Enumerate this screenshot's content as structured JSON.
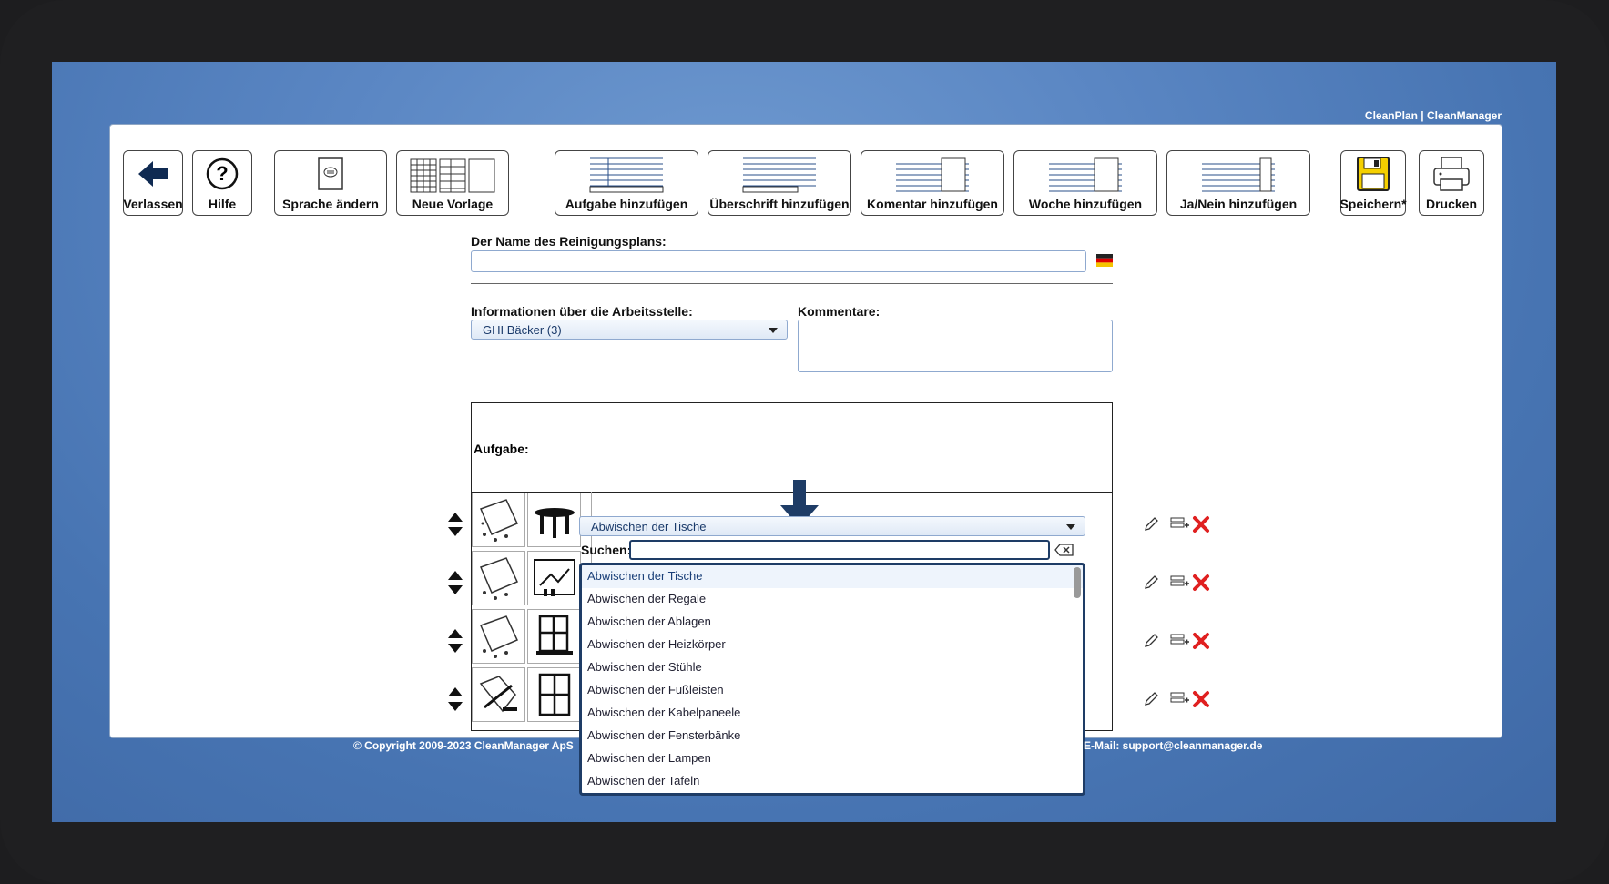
{
  "app": {
    "brand": "CleanPlan | CleanManager"
  },
  "toolbar": [
    {
      "label": "Verlassen",
      "icon": "arrow-left-icon"
    },
    {
      "label": "Hilfe",
      "icon": "help-icon"
    },
    {
      "label": "Sprache ändern",
      "icon": "language-icon"
    },
    {
      "label": "Neue Vorlage",
      "icon": "new-template-icon"
    },
    {
      "label": "Aufgabe hinzufügen",
      "icon": "add-task-icon"
    },
    {
      "label": "Überschrift hinzufügen",
      "icon": "add-heading-icon"
    },
    {
      "label": "Komentar hinzufügen",
      "icon": "add-comment-icon"
    },
    {
      "label": "Woche hinzufügen",
      "icon": "add-week-icon"
    },
    {
      "label": "Ja/Nein hinzufügen",
      "icon": "add-yes-no-icon"
    },
    {
      "label": "Speichern*",
      "icon": "save-icon"
    },
    {
      "label": "Drucken",
      "icon": "print-icon"
    }
  ],
  "form": {
    "plan_name_label": "Der Name des Reinigungsplans:",
    "plan_name_value": "",
    "workplace_label": "Informationen über die Arbeitsstelle:",
    "workplace_value": "GHI Bäcker (3)",
    "comments_label": "Kommentare:",
    "comments_value": ""
  },
  "tasks": {
    "header": "Aufgabe:",
    "selected": "Abwischen der Tische",
    "search_label": "Suchen:",
    "search_value": "",
    "options": [
      "Abwischen der Tische",
      "Abwischen der Regale",
      "Abwischen der Ablagen",
      "Abwischen der Heizkörper",
      "Abwischen der Stühle",
      "Abwischen der Fußleisten",
      "Abwischen der Kabelpaneele",
      "Abwischen der Fensterbänke",
      "Abwischen der Lampen",
      "Abwischen der Tafeln"
    ]
  },
  "footer": {
    "copyright": "© Copyright 2009-2023 CleanManager ApS",
    "email": "E-Mail: support@cleanmanager.de"
  },
  "colors": {
    "desktop": "#5a86c3",
    "accent": "#1e3c66",
    "delete": "#e02020",
    "save": "#f5d000"
  }
}
